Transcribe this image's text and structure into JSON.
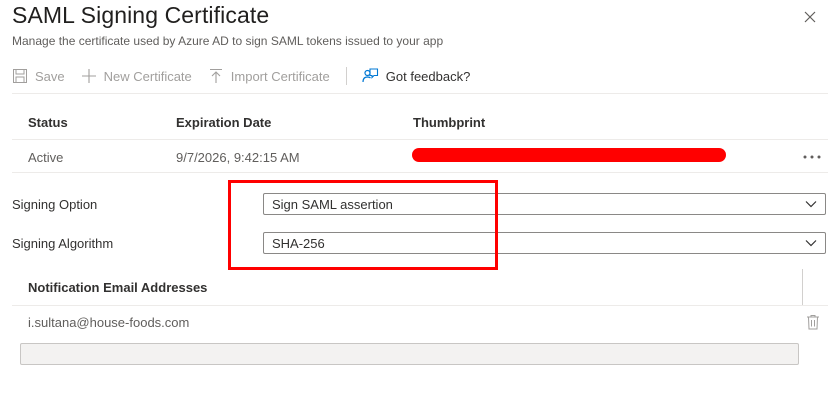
{
  "header": {
    "title": "SAML Signing Certificate",
    "subtitle": "Manage the certificate used by Azure AD to sign SAML tokens issued to your app"
  },
  "toolbar": {
    "save_label": "Save",
    "new_certificate_label": "New Certificate",
    "import_certificate_label": "Import Certificate",
    "feedback_label": "Got feedback?"
  },
  "certificates": {
    "columns": [
      "Status",
      "Expiration Date",
      "Thumbprint"
    ],
    "rows": [
      {
        "status": "Active",
        "expiration": "9/7/2026, 9:42:15 AM"
      }
    ]
  },
  "signing": {
    "option_label": "Signing Option",
    "option_value": "Sign SAML assertion",
    "algorithm_label": "Signing Algorithm",
    "algorithm_value": "SHA-256"
  },
  "notifications": {
    "header": "Notification Email Addresses",
    "emails": [
      "i.sultana@house-foods.com"
    ],
    "new_email_value": ""
  },
  "colors": {
    "annotation": "#ff0000",
    "accent": "#0078d4",
    "disabled_text": "#a19f9d"
  }
}
